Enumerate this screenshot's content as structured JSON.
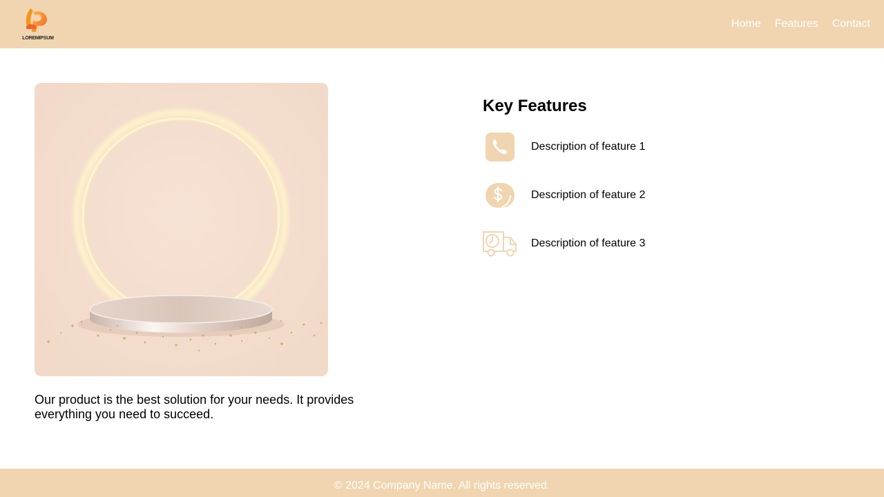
{
  "header": {
    "logo_text": "LOREMIPSUM",
    "nav": [
      {
        "label": "Home"
      },
      {
        "label": "Features"
      },
      {
        "label": "Contact"
      }
    ]
  },
  "main": {
    "description": "Our product is the best solution for your needs. It provides everything you need to succeed."
  },
  "features": {
    "title": "Key Features",
    "items": [
      {
        "icon": "phone-icon",
        "label": "Description of feature 1"
      },
      {
        "icon": "coin-dollar-icon",
        "label": "Description of feature 2"
      },
      {
        "icon": "delivery-truck-icon",
        "label": "Description of feature 3"
      }
    ]
  },
  "footer": {
    "text": "© 2024 Company Name. All rights reserved."
  },
  "colors": {
    "accent": "#f0d5b0",
    "hero_background": "#f3ddcd"
  }
}
